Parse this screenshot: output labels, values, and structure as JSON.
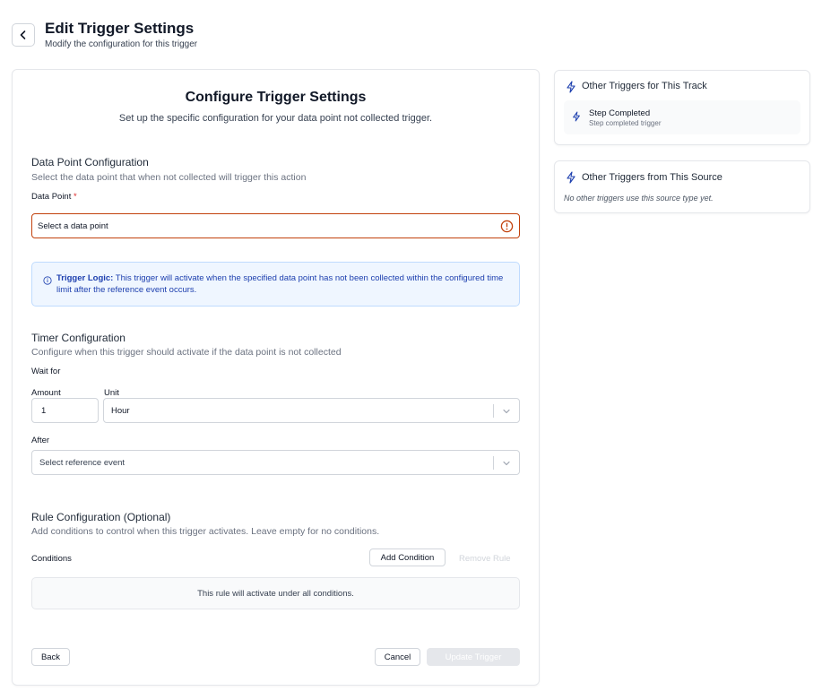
{
  "header": {
    "title": "Edit Trigger Settings",
    "subtitle": "Modify the configuration for this trigger"
  },
  "card": {
    "title": "Configure Trigger Settings",
    "subtitle": "Set up the specific configuration for your data point not collected trigger."
  },
  "data_point_section": {
    "title": "Data Point Configuration",
    "description": "Select the data point that when not collected will trigger this action",
    "field_label": "Data Point",
    "required_mark": "*",
    "placeholder": "Select a data point"
  },
  "info": {
    "label": "Trigger Logic:",
    "text": " This trigger will activate when the specified data point has not been collected within the configured time limit after the reference event occurs."
  },
  "timer_section": {
    "title": "Timer Configuration",
    "description": "Configure when this trigger should activate if the data point is not collected",
    "wait_for_label": "Wait for",
    "amount_label": "Amount",
    "amount_value": "1",
    "unit_label": "Unit",
    "unit_value": "Hour",
    "after_label": "After",
    "after_placeholder": "Select reference event"
  },
  "rule_section": {
    "title": "Rule Configuration (Optional)",
    "description": "Add conditions to control when this trigger activates. Leave empty for no conditions.",
    "conditions_label": "Conditions",
    "add_condition": "Add Condition",
    "remove_rule": "Remove Rule",
    "empty_text": "This rule will activate under all conditions."
  },
  "footer": {
    "back": "Back",
    "cancel": "Cancel",
    "update": "Update Trigger"
  },
  "sidebar": {
    "track_title": "Other Triggers for This Track",
    "track_items": [
      {
        "name": "Step Completed",
        "description": "Step completed trigger"
      }
    ],
    "source_title": "Other Triggers from This Source",
    "source_empty": "No other triggers use this source type yet."
  },
  "colors": {
    "accent": "#1e40af",
    "error_border": "#c2410c",
    "info_bg": "#eff6ff"
  },
  "icons": {
    "back": "chevron-left-icon",
    "error": "alert-circle-icon",
    "info": "info-icon",
    "select": "chevron-down-icon",
    "trigger": "lightning-bolt-icon"
  }
}
